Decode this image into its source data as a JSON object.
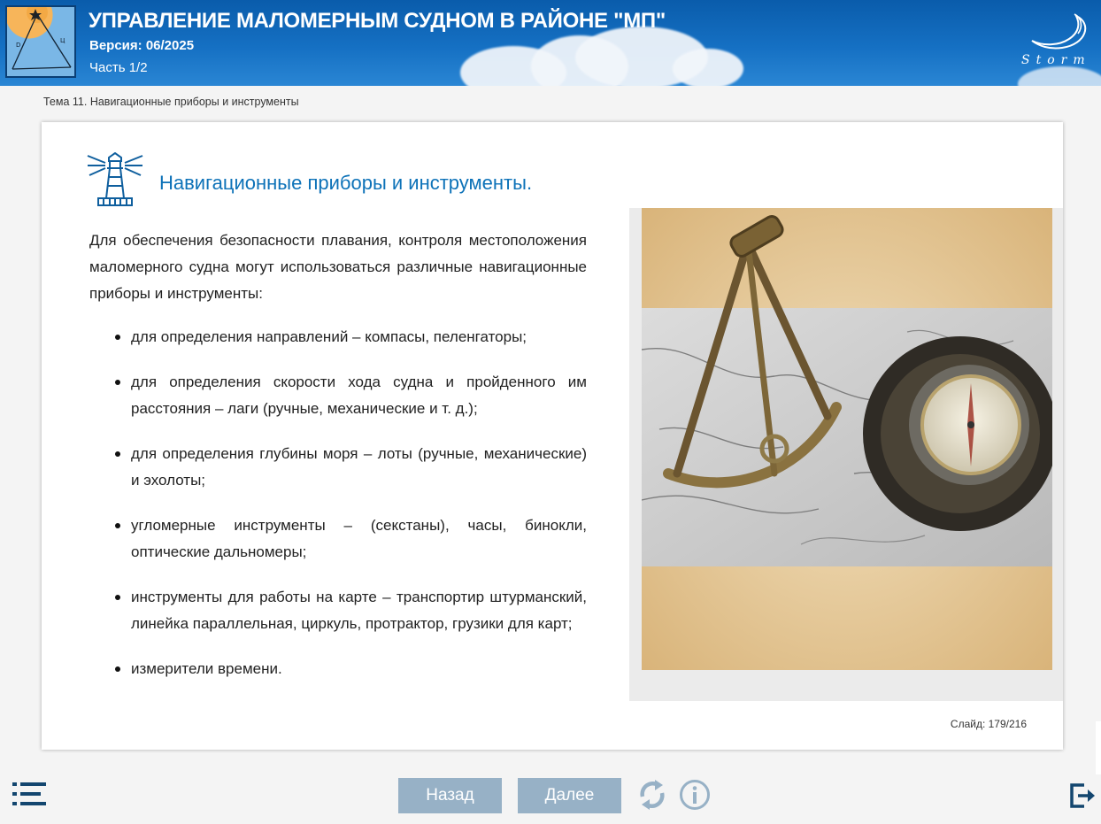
{
  "header": {
    "title": "УПРАВЛЕНИЕ МАЛОМЕРНЫМ СУДНОМ В РАЙОНЕ \"МП\"",
    "version": "Версия: 06/2025",
    "part": "Часть 1/2",
    "brand": "Storm"
  },
  "breadcrumb": "Тема 11. Навигационные приборы и инструменты",
  "slide": {
    "heading": "Навигационные приборы и инструменты.",
    "intro": "Для обеспечения безопасности плавания, контроля местоположения маломерного судна могут использоваться различные навигационные приборы и инструменты:",
    "bullets": [
      "для определения направлений – компасы, пеленгаторы;",
      "для определения скорости хода судна и пройденного им расстояния – лаги (ручные, механические и т. д.);",
      "для определения глубины моря – лоты (ручные, механические) и эхолоты;",
      "угломерные инструменты – (секстаны), часы, бинокли, оптические дальномеры;",
      "инструменты для работы на карте – транспортир штурманский, линейка параллельная, циркуль, протрактор, грузики для карт;",
      "измерители времени."
    ],
    "counter": "Слайд:  179/216"
  },
  "footer": {
    "back_label": "Назад",
    "next_label": "Далее"
  },
  "icons": {
    "menu": "menu-list-icon",
    "reload": "reload-icon",
    "info": "info-icon",
    "exit": "exit-icon",
    "lighthouse": "lighthouse-icon"
  },
  "colors": {
    "header_blue": "#0a5cab",
    "heading_blue": "#0d72b8",
    "button": "#97b1c6",
    "dark_icon": "#13466f"
  }
}
